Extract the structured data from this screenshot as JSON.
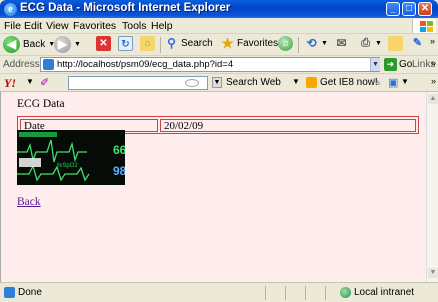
{
  "window": {
    "title": "ECG Data - Microsoft Internet Explorer",
    "app_icon": "e",
    "min_icon": "_",
    "max_icon": "□",
    "close_icon": "✕"
  },
  "menu": [
    "File",
    "Edit",
    "View",
    "Favorites",
    "Tools",
    "Help"
  ],
  "toolbar": {
    "back_label": "Back",
    "search_label": "Search",
    "favorites_label": "Favorites"
  },
  "address": {
    "label": "Address",
    "url": "http://localhost/psm09/ecg_data.php?id=4",
    "go_label": "Go",
    "links_label": "Links"
  },
  "yahoo_bar": {
    "logo": "Y!",
    "search_label": "Search Web",
    "ie8_label": "Get IE8 now!"
  },
  "page": {
    "heading": "ECG Data",
    "table": [
      {
        "label": "Date",
        "value": "20/02/09"
      }
    ],
    "monitor_readings": {
      "hr": "66",
      "spo2": "98"
    },
    "back_link": "Back"
  },
  "status": {
    "text": "Done",
    "zone": "Local intranet"
  },
  "colors": {
    "content_bg": "#ffedee",
    "table_border": "#cc4444",
    "link": "#551a8b",
    "titlebar": "#0045c8"
  }
}
